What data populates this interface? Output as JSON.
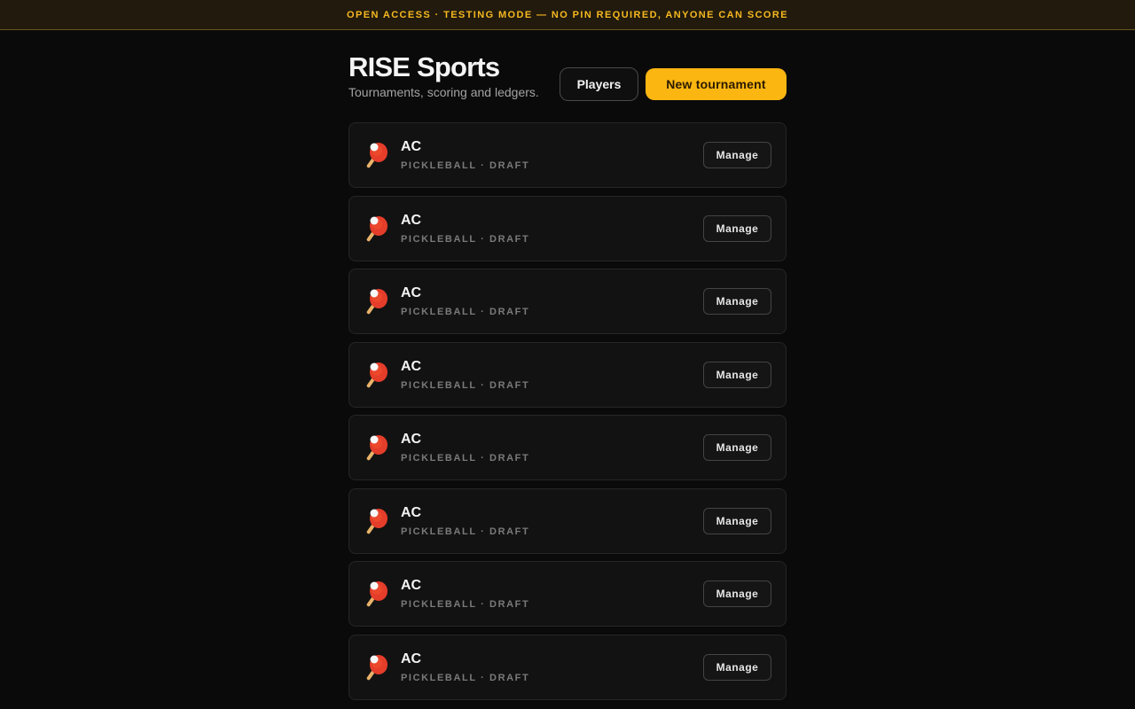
{
  "banner": {
    "text": "OPEN ACCESS · TESTING MODE — NO PIN REQUIRED, ANYONE CAN SCORE"
  },
  "header": {
    "title": "RISE Sports",
    "subtitle": "Tournaments, scoring and ledgers.",
    "players_label": "Players",
    "new_tournament_label": "New tournament"
  },
  "colors": {
    "background": "#0a0a0a",
    "accent": "#fbb611",
    "banner_text": "#f6b820",
    "card": "#121212"
  },
  "tournaments": [
    {
      "name": "AC",
      "meta": "PICKLEBALL · DRAFT",
      "icon": "ping-pong-paddle-icon",
      "action": "Manage"
    },
    {
      "name": "AC",
      "meta": "PICKLEBALL · DRAFT",
      "icon": "ping-pong-paddle-icon",
      "action": "Manage"
    },
    {
      "name": "AC",
      "meta": "PICKLEBALL · DRAFT",
      "icon": "ping-pong-paddle-icon",
      "action": "Manage"
    },
    {
      "name": "AC",
      "meta": "PICKLEBALL · DRAFT",
      "icon": "ping-pong-paddle-icon",
      "action": "Manage"
    },
    {
      "name": "AC",
      "meta": "PICKLEBALL · DRAFT",
      "icon": "ping-pong-paddle-icon",
      "action": "Manage"
    },
    {
      "name": "AC",
      "meta": "PICKLEBALL · DRAFT",
      "icon": "ping-pong-paddle-icon",
      "action": "Manage"
    },
    {
      "name": "AC",
      "meta": "PICKLEBALL · DRAFT",
      "icon": "ping-pong-paddle-icon",
      "action": "Manage"
    },
    {
      "name": "AC",
      "meta": "PICKLEBALL · DRAFT",
      "icon": "ping-pong-paddle-icon",
      "action": "Manage"
    }
  ]
}
